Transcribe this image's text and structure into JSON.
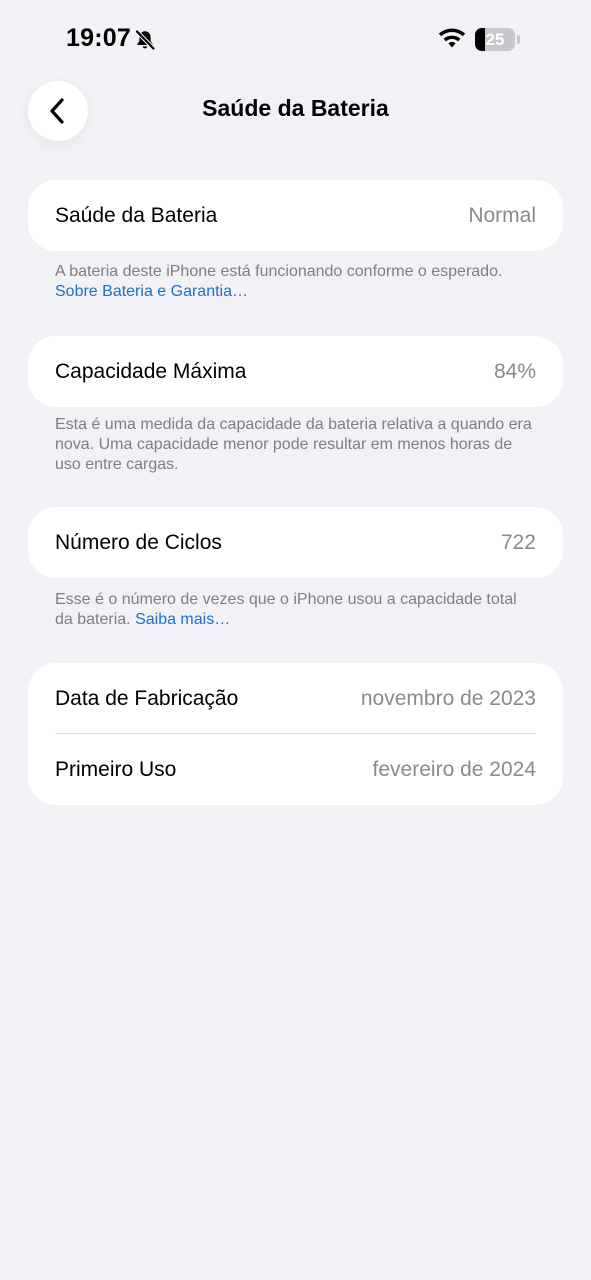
{
  "status_bar": {
    "time": "19:07",
    "silent_icon": "bell-slash-icon",
    "wifi_icon": "wifi-icon",
    "battery_level": "25",
    "battery_fill_percent": 25
  },
  "nav": {
    "back_icon": "chevron-left-icon",
    "title": "Saúde da Bateria"
  },
  "battery_health": {
    "label": "Saúde da Bateria",
    "value": "Normal",
    "footnote_text": "A bateria deste iPhone está funcionando conforme o esperado. ",
    "footnote_link": "Sobre Bateria e Garantia…"
  },
  "max_capacity": {
    "label": "Capacidade Máxima",
    "value": "84%",
    "footnote_text": "Esta é uma medida da capacidade da bateria relativa a quando era nova. Uma capacidade menor pode resultar em menos horas de uso entre cargas."
  },
  "cycle_count": {
    "label": "Número de Ciclos",
    "value": "722",
    "footnote_text": "Esse é o número de vezes que o iPhone usou a capacidade total da bateria. ",
    "footnote_link": "Saiba mais…"
  },
  "dates": {
    "manufacture_label": "Data de Fabricação",
    "manufacture_value": "novembro de 2023",
    "first_use_label": "Primeiro Uso",
    "first_use_value": "fevereiro de 2024"
  },
  "colors": {
    "background": "#f2f1f6",
    "card": "#ffffff",
    "secondary_text": "#8a8a8e",
    "link": "#1a73c8"
  }
}
